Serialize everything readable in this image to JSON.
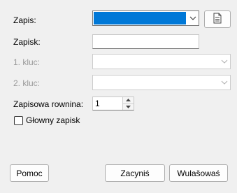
{
  "form": {
    "record_label": "Zapis:",
    "entry_label": "Zapisk:",
    "entry_value": "",
    "key1_label": "1. kluc:",
    "key2_label": "2. kluc:",
    "level_label": "Zapisowa rownina:",
    "level_value": "1",
    "main_entry_label": "Głowny zapisk",
    "main_entry_checked": false
  },
  "buttons": {
    "help": "Pomoc",
    "close": "Zacyniś",
    "properties": "Wulašowaś"
  },
  "icons": {
    "record_browse": "document-list-icon",
    "dropdown": "chevron-down-icon",
    "spin_up": "spin-up-icon",
    "spin_down": "spin-down-icon"
  },
  "colors": {
    "selection": "#0078d7",
    "background": "#f0f0f0",
    "disabled_text": "#9a9a9a"
  }
}
